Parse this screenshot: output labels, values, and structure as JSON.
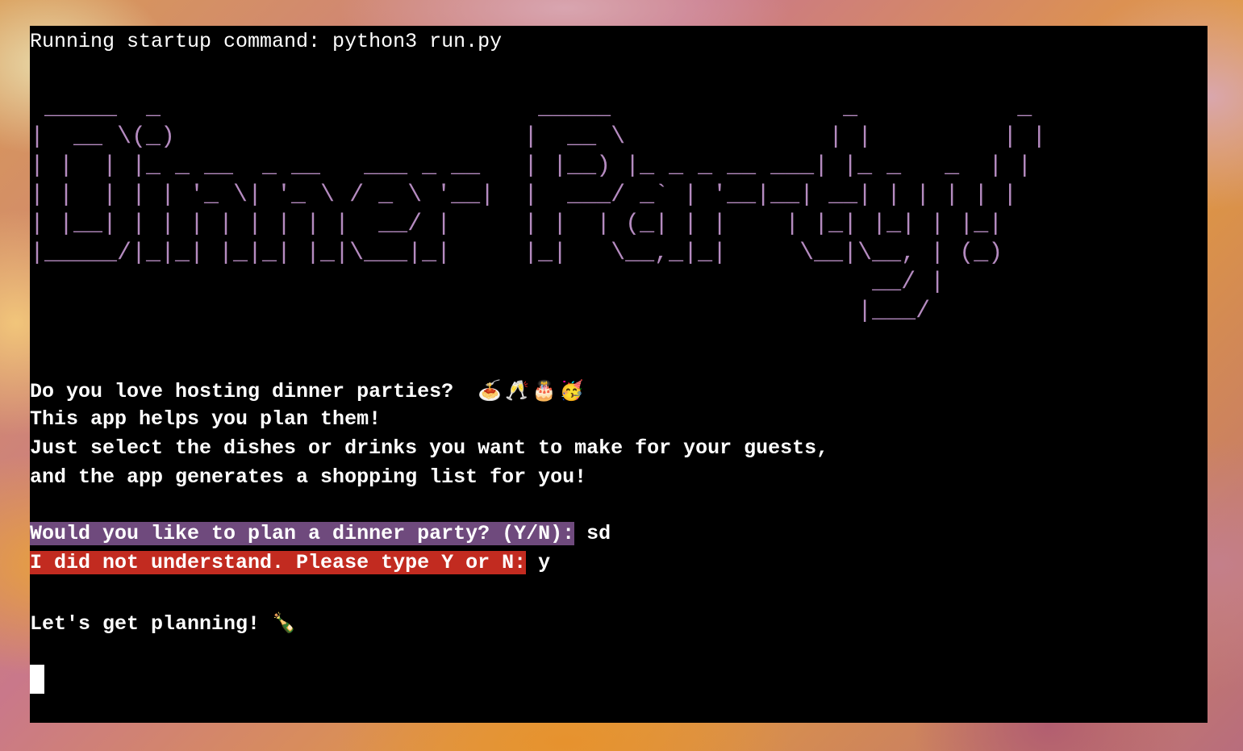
{
  "terminal": {
    "startup_line": "Running startup command: python3 run.py",
    "banner_ascii": [
      " _____  _                          _____                _           _ ",
      "|  __ \\(_)                        |  __ \\              | |         | |",
      "| |  | |_ _ __  _ __   ___ _ __   | |__) |_ _ _ __ ___| |_ _   _  | |",
      "| |  | | | '_ \\| '_ \\ / _ \\ '__|  |  ___/ _` | '__|__| __| | | | | |",
      "| |__| | | | | | | | |  __/ |     | |  | (_| | |    | |_| |_| | |_|",
      "|_____/|_|_| |_|_| |_|\\___|_|     |_|   \\__,_|_|     \\__|\\__, | (_)",
      "                                                          __/ |    ",
      "                                                         |___/     "
    ],
    "intro_line_1": "Do you love hosting dinner parties?",
    "intro_emojis": "🍝🥂🎂🥳",
    "intro_line_2": "This app helps you plan them!",
    "intro_line_3": "Just select the dishes or drinks you want to make for your guests,",
    "intro_line_4": "and the app generates a shopping list for you!",
    "prompt_1": "Would you like to plan a dinner party? (Y/N):",
    "answer_1": "sd",
    "prompt_2": "I did not understand. Please type Y or N:",
    "answer_2": "y",
    "plan_line": "Let's get planning!",
    "plan_emoji": "🍾",
    "colors": {
      "banner": "#b58bc0",
      "prompt_highlight": "#6f4a7d",
      "error_highlight": "#c22b20"
    }
  }
}
